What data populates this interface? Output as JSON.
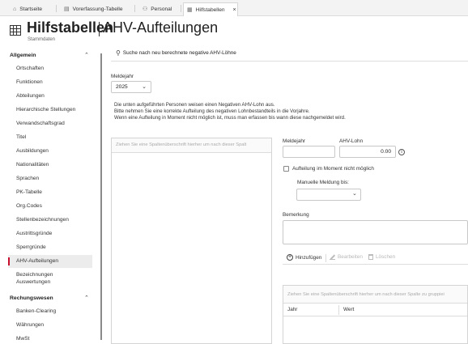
{
  "tabs": [
    {
      "label": "Startseite",
      "icon": "home-icon"
    },
    {
      "label": "Vorerfassung-Tabelle",
      "icon": "table-icon"
    },
    {
      "label": "Personal",
      "icon": "people-icon"
    },
    {
      "label": "Hilfstabellen",
      "icon": "grid-icon",
      "active": true
    }
  ],
  "header": {
    "title": "Hilfstabellen",
    "subtitle": "AHV-Aufteilungen",
    "breadcrumb": "Stammdaten"
  },
  "sidebar": {
    "groups": [
      {
        "label": "Allgemein",
        "items": [
          "Ortschaften",
          "Funktionen",
          "Abteilungen",
          "Hierarchische Stellungen",
          "Verwandschaftsgrad",
          "Titel",
          "Ausbildungen",
          "Nationalitäten",
          "Sprachen",
          "PK-Tabelle",
          "Org.Codes",
          "Stellenbezeichnungen",
          "Austrittsgründe",
          "Sperrgründe",
          "AHV-Aufteilungen",
          "Bezeichnungen Auswertungen"
        ]
      },
      {
        "label": "Rechungswesen",
        "items": [
          "Banken-Clearing",
          "Währungen",
          "MwSt"
        ]
      }
    ],
    "active_item": "AHV-Aufteilungen"
  },
  "main": {
    "search_link": "Suche nach neu berechnete negative AHV-Löhne",
    "meldejahr_label": "Meldejahr",
    "meldejahr_value": "2025",
    "info_lines": [
      "Die unten aufgeführten Personen weisen einen Negativen AHV-Lohn aus.",
      "Bitte nehmen Sie eine korrekte Aufteilung des negativen Lohnbestandteils in die Vorjahre.",
      "Wenn eine Aufteilung in Moment nicht möglich ist, muss man erfassen bis wann diese nachgemeldet wird."
    ],
    "left_grid": {
      "drop_hint": "Ziehen Sie eine Spaltenüberschrift hierher um nach dieser Spalt"
    },
    "form": {
      "meldejahr_label": "Meldejahr",
      "meldejahr_value": "",
      "ahv_lohn_label": "AHV-Lohn",
      "ahv_lohn_value": "0.00",
      "checkbox_label": "Aufteilung im Moment nicht möglich",
      "checkbox_checked": false,
      "manuelle_label": "Manuelle Meldung bis:",
      "manuelle_value": "",
      "bemerkung_label": "Bemerkung",
      "bemerkung_value": ""
    },
    "toolbar": {
      "add": "Hinzufügen",
      "edit": "Bearbeiten",
      "delete": "Löschen"
    },
    "right_grid": {
      "drop_hint": "Ziehen Sie eine Spaltenüberschrift hierher um nach dieser Spalte zu gruppiei",
      "columns": [
        "Jahr",
        "Wert"
      ]
    }
  }
}
